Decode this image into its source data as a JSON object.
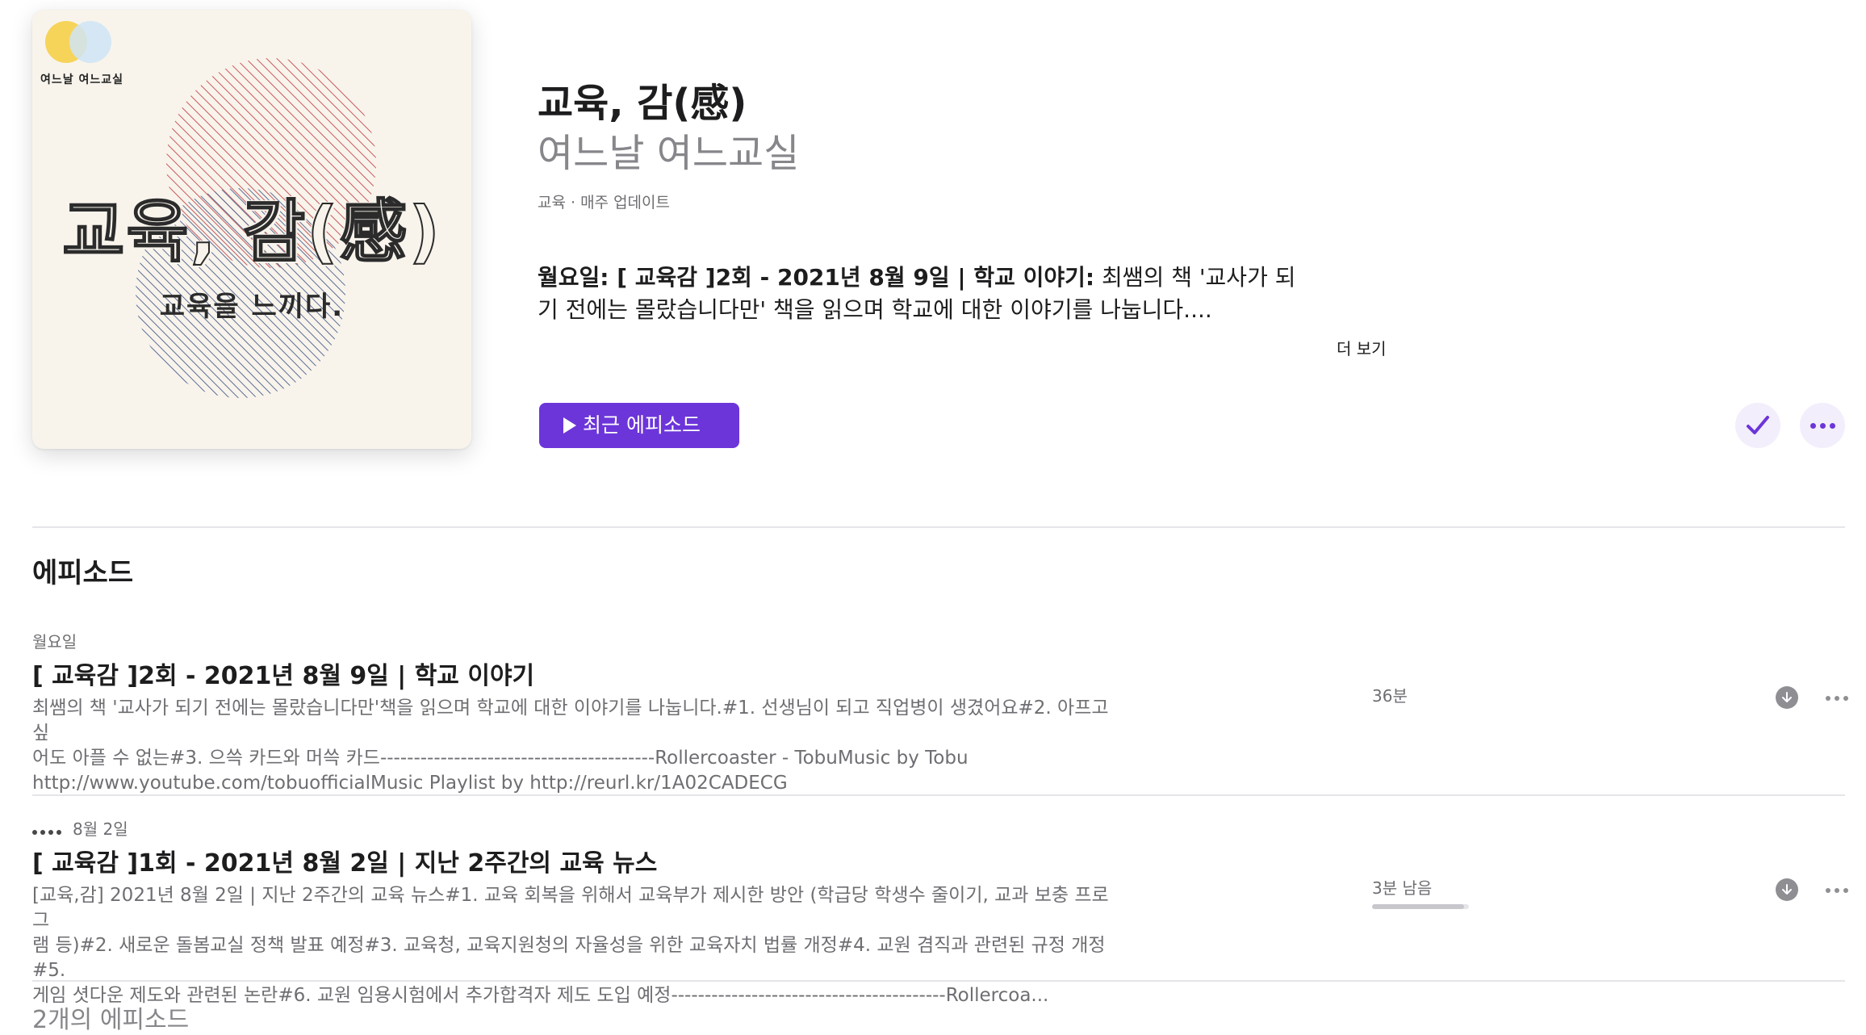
{
  "show": {
    "artwork": {
      "logo_text": "여느날 여느교실",
      "title_text": "교육, 감(感)",
      "subtitle_text": "교육을 느끼다.",
      "colors": {
        "background": "#f8f4ec",
        "logo_yellow": "#f6d45a",
        "logo_blue": "#cfe4f6",
        "circle_red": "#c9595c",
        "circle_blue": "#5d6d96",
        "ink": "#2b2b2b"
      }
    },
    "title": "교육, 감(感)",
    "author": "여느날 여느교실",
    "meta": "교육 · 매주 업데이트",
    "description_bold": "월요일: [ 교육감 ]2회 -  2021년 8월 9일 | 학교 이야기:",
    "description_rest": " 최쌤의 책 '교사가 되기 전에는 몰랐습니다만' 책을 읽으며 학교에 대한 이야기를 나눕니다....",
    "more_label": "더 보기",
    "play_label": "최근 에피소드",
    "play_icon": "play-icon",
    "follow_icon": "checkmark-icon",
    "menu_icon": "ellipsis-icon",
    "accent_color": "#6c35d9"
  },
  "episodes_section": {
    "heading": "에피소드",
    "count_label": "2개의 에피소드"
  },
  "episodes": [
    {
      "date": "월요일",
      "title": "[ 교육감 ]2회 -  2021년 8월 9일 | 학교 이야기",
      "summary_lines": [
        "최쌤의 책 '교사가 되기 전에는 몰랐습니다만'책을 읽으며 학교에 대한 이야기를 나눕니다.#1. 선생님이 되고 직업병이 생겼어요#2. 아프고 싶",
        "어도 아플 수 없는#3. 으쓱 카드와 머쓱 카드-----------------------------------------Rollercoaster - TobuMusic by Tobu",
        "http://www.youtube.com/tobuofficialMusic Playlist by http://reurl.kr/1A02CADECG"
      ],
      "duration": "36분",
      "download_icon": "download-icon",
      "more_icon": "ellipsis-icon"
    },
    {
      "date": "8월 2일",
      "date_prefix_icon": "played-dots-icon",
      "title": "[ 교육감 ]1회 -  2021년 8월 2일 | 지난 2주간의 교육 뉴스",
      "summary_lines": [
        "[교육,감] 2021년 8월 2일 | 지난 2주간의 교육 뉴스#1. 교육 회복을 위해서 교육부가 제시한 방안 (학급당 학생수 줄이기, 교과 보충 프로그",
        "램 등)#2. 새로운 돌봄교실 정책 발표 예정#3. 교육청, 교육지원청의 자율성을 위한 교육자치 법률 개정#4. 교원 겸직과 관련된 규정 개정#5.",
        "게임 셧다운 제도와 관련된 논란#6. 교원 임용시험에서 추가합격자 제도 도입 예정-----------------------------------------Rollercoa..."
      ],
      "duration": "3분 남음",
      "progress_fraction": 0.95,
      "download_icon": "download-icon",
      "more_icon": "ellipsis-icon"
    }
  ]
}
